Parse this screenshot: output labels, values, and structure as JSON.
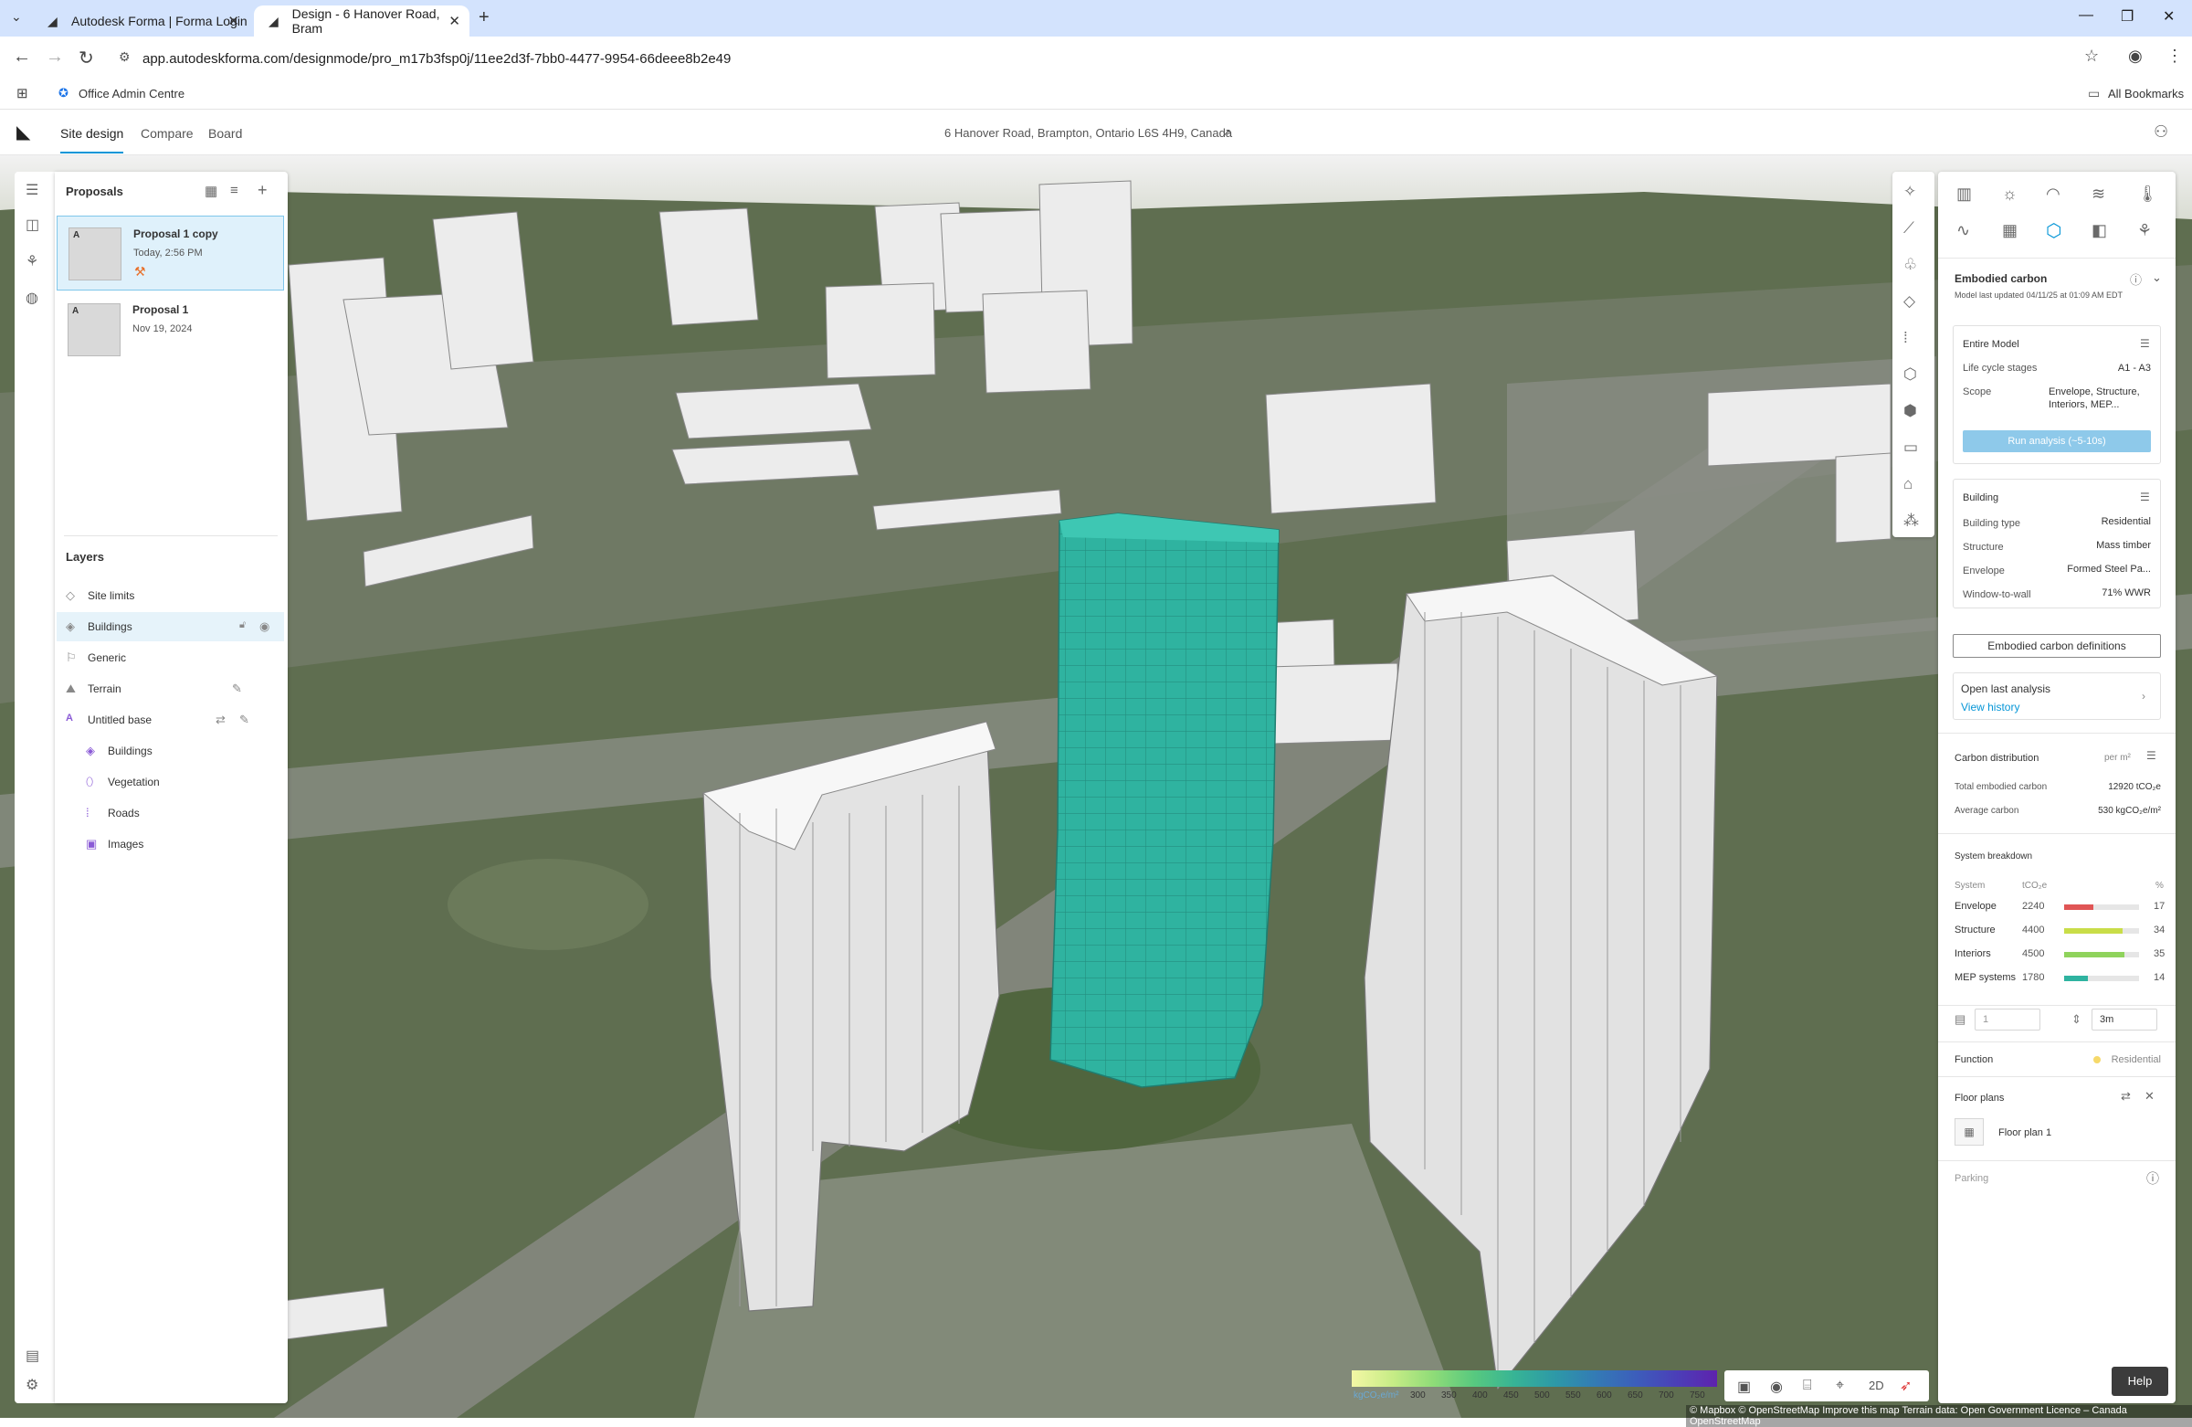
{
  "browser": {
    "tabs": [
      {
        "title": "Autodesk Forma | Forma Login"
      },
      {
        "title": "Design - 6 Hanover Road, Bram"
      }
    ],
    "url": "app.autodeskforma.com/designmode/pro_m17b3fsp0j/11ee2d3f-7bb0-4477-9954-66deee8b2e49",
    "bookmarks": {
      "item": "Office Admin Centre",
      "all": "All Bookmarks"
    }
  },
  "header": {
    "tabs": [
      "Site design",
      "Compare",
      "Board"
    ],
    "address": "6 Hanover Road, Brampton, Ontario L6S 4H9, Canada"
  },
  "proposals": {
    "title": "Proposals",
    "items": [
      {
        "name": "Proposal 1 copy",
        "date": "Today, 2:56 PM",
        "thumb": "A"
      },
      {
        "name": "Proposal 1",
        "date": "Nov 19, 2024",
        "thumb": "A"
      }
    ]
  },
  "layers": {
    "title": "Layers",
    "items": [
      {
        "label": "Site limits"
      },
      {
        "label": "Buildings"
      },
      {
        "label": "Generic"
      },
      {
        "label": "Terrain"
      },
      {
        "label": "Untitled base"
      },
      {
        "label": "Buildings"
      },
      {
        "label": "Vegetation"
      },
      {
        "label": "Roads"
      },
      {
        "label": "Images"
      }
    ]
  },
  "embodied": {
    "title": "Embodied carbon",
    "updated": "Model last updated 04/11/25 at 01:09 AM EDT",
    "scope_card": {
      "title": "Entire Model",
      "rows": [
        {
          "label": "Life cycle stages",
          "value": "A1 - A3"
        },
        {
          "label": "Scope",
          "value": "Envelope, Structure,",
          "value2": "Interiors, MEP..."
        }
      ],
      "run": "Run analysis (~5-10s)"
    },
    "building_card": {
      "title": "Building",
      "rows": [
        {
          "label": "Building type",
          "value": "Residential"
        },
        {
          "label": "Structure",
          "value": "Mass timber"
        },
        {
          "label": "Envelope",
          "value": "Formed Steel Pa..."
        },
        {
          "label": "Window-to-wall",
          "value": "71% WWR"
        }
      ]
    },
    "definitions": "Embodied carbon definitions",
    "last_analysis": {
      "title": "Open last analysis",
      "link": "View history"
    },
    "distribution": {
      "title": "Carbon distribution",
      "unit": "per m²",
      "total_label": "Total embodied carbon",
      "total": "12920 tCO₂e",
      "avg_label": "Average carbon",
      "avg": "530 kgCO₂e/m²"
    },
    "breakdown": {
      "title": "System breakdown",
      "headers": [
        "System",
        "tCO₂e",
        "%"
      ],
      "rows": [
        {
          "name": "Envelope",
          "value": "2240",
          "pct": 17,
          "pct_label": "17",
          "color": "#e05555"
        },
        {
          "name": "Structure",
          "value": "4400",
          "pct": 34,
          "pct_label": "34",
          "color": "#c9dd48"
        },
        {
          "name": "Interiors",
          "value": "4500",
          "pct": 35,
          "pct_label": "35",
          "color": "#8fd35c"
        },
        {
          "name": "MEP systems",
          "value": "1780",
          "pct": 14,
          "pct_label": "14",
          "color": "#2fb3a0"
        }
      ]
    }
  },
  "properties": {
    "floors": "1",
    "height": "3m",
    "function_label": "Function",
    "function_value": "Residential",
    "floor_plans": "Floor plans",
    "floor_plan_item": "Floor plan 1",
    "parking": "Parking"
  },
  "legend": {
    "unit": "kgCO₂e/m²",
    "ticks": [
      "300",
      "350",
      "400",
      "450",
      "500",
      "550",
      "600",
      "650",
      "700",
      "750"
    ]
  },
  "view_tools": {
    "mode": "2D"
  },
  "help": "Help",
  "attribution": "© Mapbox © OpenStreetMap  Improve this map  Terrain data: Open Government Licence – Canada  OpenStreetMap",
  "colors": {
    "accent": "#0696d7",
    "selected_building": "#2fb3a0",
    "run_button": "#8ec9ea"
  }
}
